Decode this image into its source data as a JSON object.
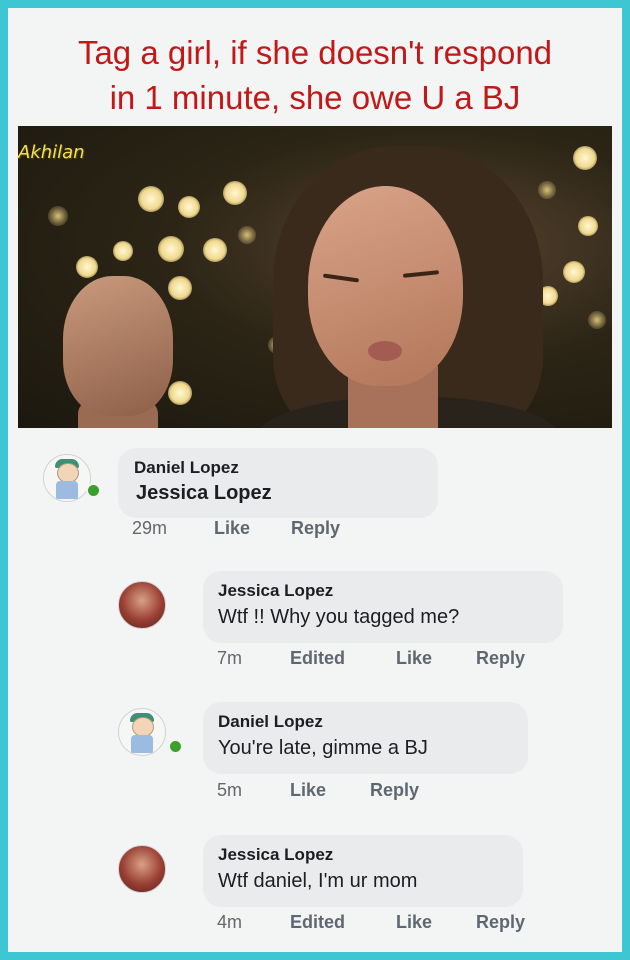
{
  "caption": {
    "line1": "Tag a girl, if she doesn't respond",
    "line2": "in 1 minute, she owe U a BJ"
  },
  "image": {
    "watermark": "Akhilan"
  },
  "comments": [
    {
      "author": "Daniel Lopez",
      "text": "Jessica Lopez",
      "time": "29m",
      "edited": "",
      "like": "Like",
      "reply": "Reply",
      "avatar": "daniel-avatar",
      "online": true
    },
    {
      "author": "Jessica Lopez",
      "text": "Wtf !! Why you tagged me?",
      "time": "7m",
      "edited": "Edited",
      "like": "Like",
      "reply": "Reply",
      "avatar": "jessica-avatar",
      "online": false
    },
    {
      "author": "Daniel Lopez",
      "text": "You're late,  gimme a BJ",
      "time": "5m",
      "edited": "",
      "like": "Like",
      "reply": "Reply",
      "avatar": "daniel-avatar",
      "online": true
    },
    {
      "author": "Jessica Lopez",
      "text": "Wtf daniel, I'm ur mom",
      "time": "4m",
      "edited": "Edited",
      "like": "Like",
      "reply": "Reply",
      "avatar": "jessica-avatar",
      "online": false
    }
  ],
  "colors": {
    "border": "#3fc6d3",
    "caption": "#c21818",
    "bubble": "#e9ebed",
    "online": "#3aa02a"
  }
}
